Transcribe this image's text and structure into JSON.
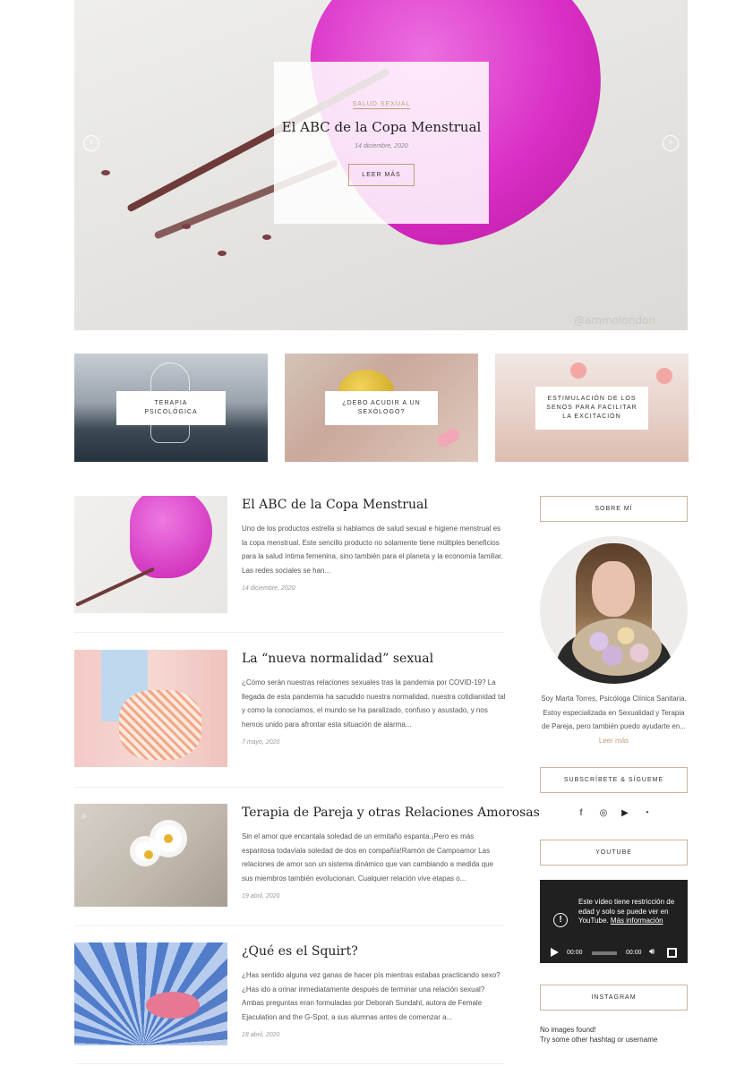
{
  "hero": {
    "category": "SALUD SEXUAL",
    "title": "El ABC de la Copa Menstrual",
    "date": "14 diciembre, 2020",
    "button": "LEER MÁS",
    "watermark": "@ammolondon",
    "prev_icon": "chevron-left-icon",
    "next_icon": "chevron-right-icon"
  },
  "promos": [
    {
      "label": "TERAPIA PSICOLÓGICA"
    },
    {
      "label": "¿DEBO ACUDIR A UN SEXÓLOGO?"
    },
    {
      "label": "ESTIMULACIÓN DE LOS SENOS PARA FACILITAR LA EXCITACIÓN"
    }
  ],
  "posts": [
    {
      "title": "El ABC de la Copa Menstrual",
      "excerpt": "Uno de los productos estrella si hablamos de salud sexual e higiene menstrual es la copa menstrual. Este sencillo producto no solamente tiene múltiples beneficios para la salud íntima femenina, sino también para el planeta y la economía familiar. Las redes sociales se han...",
      "date": "14 diciembre, 2020"
    },
    {
      "title": "La “nueva normalidad” sexual",
      "excerpt": "¿Cómo serán nuestras relaciones sexuales tras la pandemia por COVID-19? La llegada de esta pandemia ha sacudido nuestra normalidad, nuestra cotidianidad tal y como la conocíamos, el mundo se ha paralizado, confuso y asustado, y nos hemos unido para afrontar esta situación de alarma...",
      "date": "7 mayo, 2020"
    },
    {
      "title": "Terapia de Pareja y otras Relaciones Amorosas",
      "excerpt": "Sin el amor que encantala soledad de un ermitaño espanta.¡Pero es más espantosa todavíala soledad de dos en compañía!Ramón de Campoamor Las relaciones de amor son un sistema dinámico que van cambiando a medida que sus miembros también evolucionan. Cualquier relación vive etapas o...",
      "date": "19 abril, 2020"
    },
    {
      "title": "¿Qué es el Squirt?",
      "excerpt": "¿Has sentido alguna vez ganas de hacer pís mientras estabas practicando sexo? ¿Has ido a orinar inmediatamente después de terminar una relación sexual? Ambas preguntas eran formuladas por Deborah Sundahl, autora de Female Ejaculation and the G-Spot, a sus alumnas antes de comenzar a...",
      "date": "18 abril, 2020"
    }
  ],
  "sidebar": {
    "about_title": "SOBRE MÍ",
    "bio": "Soy Marta Torres, Psicóloga Clínica Sanitaria. Estoy especializada en Sexualidad y Terapia de Pareja, pero también puedo ayudarte en...",
    "bio_more": "Leer más",
    "social_title": "SUBSCRÍBETE & SÍGUEME",
    "social_icons": [
      "facebook-icon",
      "instagram-icon",
      "youtube-icon",
      "rss-icon"
    ],
    "youtube_title": "YOUTUBE",
    "video": {
      "message": "Este vídeo tiene restricción de edad y solo se puede ver en YouTube.",
      "link": "Más información",
      "time_current": "00:00",
      "time_total": "00:00"
    },
    "instagram_title": "INSTAGRAM",
    "instagram_msg_1": "No images found!",
    "instagram_msg_2": "Try some other hashtag or username"
  },
  "colors": {
    "accent": "#c09d7b",
    "text": "#333333",
    "border": "#c9b49d"
  }
}
